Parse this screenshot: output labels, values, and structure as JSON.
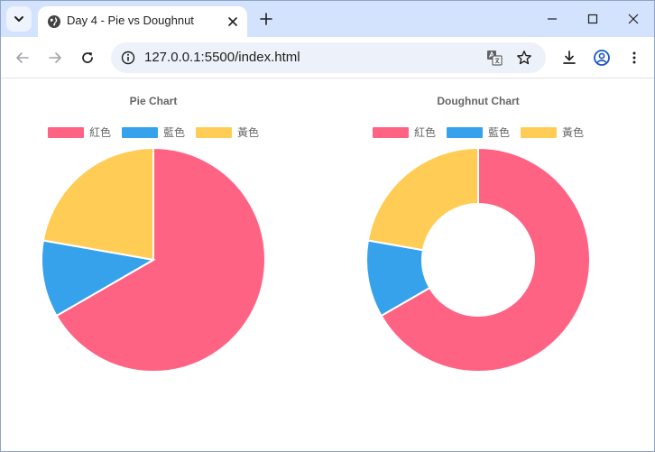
{
  "browser": {
    "tab_title": "Day 4 - Pie vs Doughnut",
    "url": "127.0.0.1:5500/index.html"
  },
  "colors": {
    "red": "#ff6384",
    "blue": "#36a2eb",
    "yellow": "#ffcd56"
  },
  "chart_data": [
    {
      "type": "pie",
      "title": "Pie Chart",
      "categories": [
        "紅色",
        "藍色",
        "黃色"
      ],
      "values": [
        300,
        50,
        100
      ],
      "colors": [
        "#ff6384",
        "#36a2eb",
        "#ffcd56"
      ],
      "legend_position": "top"
    },
    {
      "type": "doughnut",
      "title": "Doughnut Chart",
      "categories": [
        "紅色",
        "藍色",
        "黃色"
      ],
      "values": [
        300,
        50,
        100
      ],
      "colors": [
        "#ff6384",
        "#36a2eb",
        "#ffcd56"
      ],
      "legend_position": "top",
      "cutout_percent": 50
    }
  ]
}
